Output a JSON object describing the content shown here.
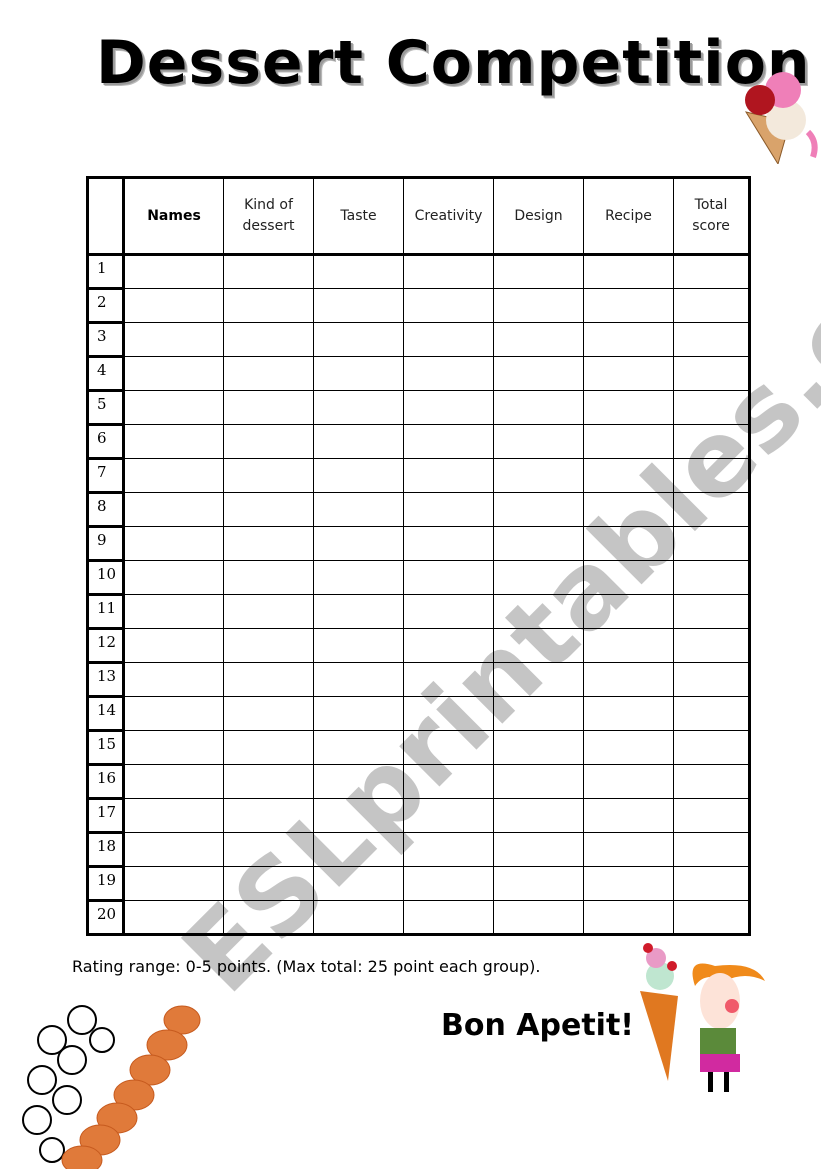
{
  "title": "Dessert Competition",
  "table": {
    "headers": [
      "",
      "Names",
      "Kind of dessert",
      "Taste",
      "Creativity",
      "Design",
      "Recipe",
      "Total score"
    ],
    "header_lines": {
      "kind": [
        "Kind of",
        "dessert"
      ],
      "total": [
        "Total",
        "score"
      ]
    },
    "rows": [
      "1",
      "2",
      "3",
      "4",
      "5",
      "6",
      "7",
      "8",
      "9",
      "10",
      "11",
      "12",
      "13",
      "14",
      "15",
      "16",
      "17",
      "18",
      "19",
      "20"
    ]
  },
  "watermark": "ESLprintables.com",
  "rating_note": "Rating range: 0-5 points. (Max total: 25 point each group).",
  "closing": "Bon Apetit!",
  "illustrations": {
    "top_right": "ice-cream-cone",
    "bottom_left": "crowd-with-cookies",
    "bottom_right": "girl-holding-ice-cream"
  }
}
